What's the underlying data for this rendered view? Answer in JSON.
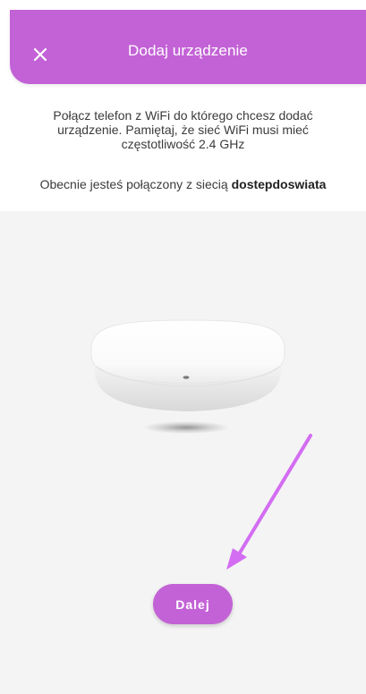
{
  "header": {
    "title": "Dodaj urządzenie",
    "close_icon": "close-icon",
    "background": "#c362d6"
  },
  "instructions": {
    "text": "Połącz telefon z WiFi do którego chcesz dodać urządzenie. Pamiętaj, że sieć WiFi musi mieć częstotliwość 2.4 GHz"
  },
  "network": {
    "prefix": "Obecnie jesteś połączony z siecią",
    "name": "dostepdoswiata"
  },
  "device": {
    "illustration": "white-square-hub-device"
  },
  "annotation": {
    "arrow_color": "#d36df2"
  },
  "actions": {
    "next_label": "Dalej"
  }
}
